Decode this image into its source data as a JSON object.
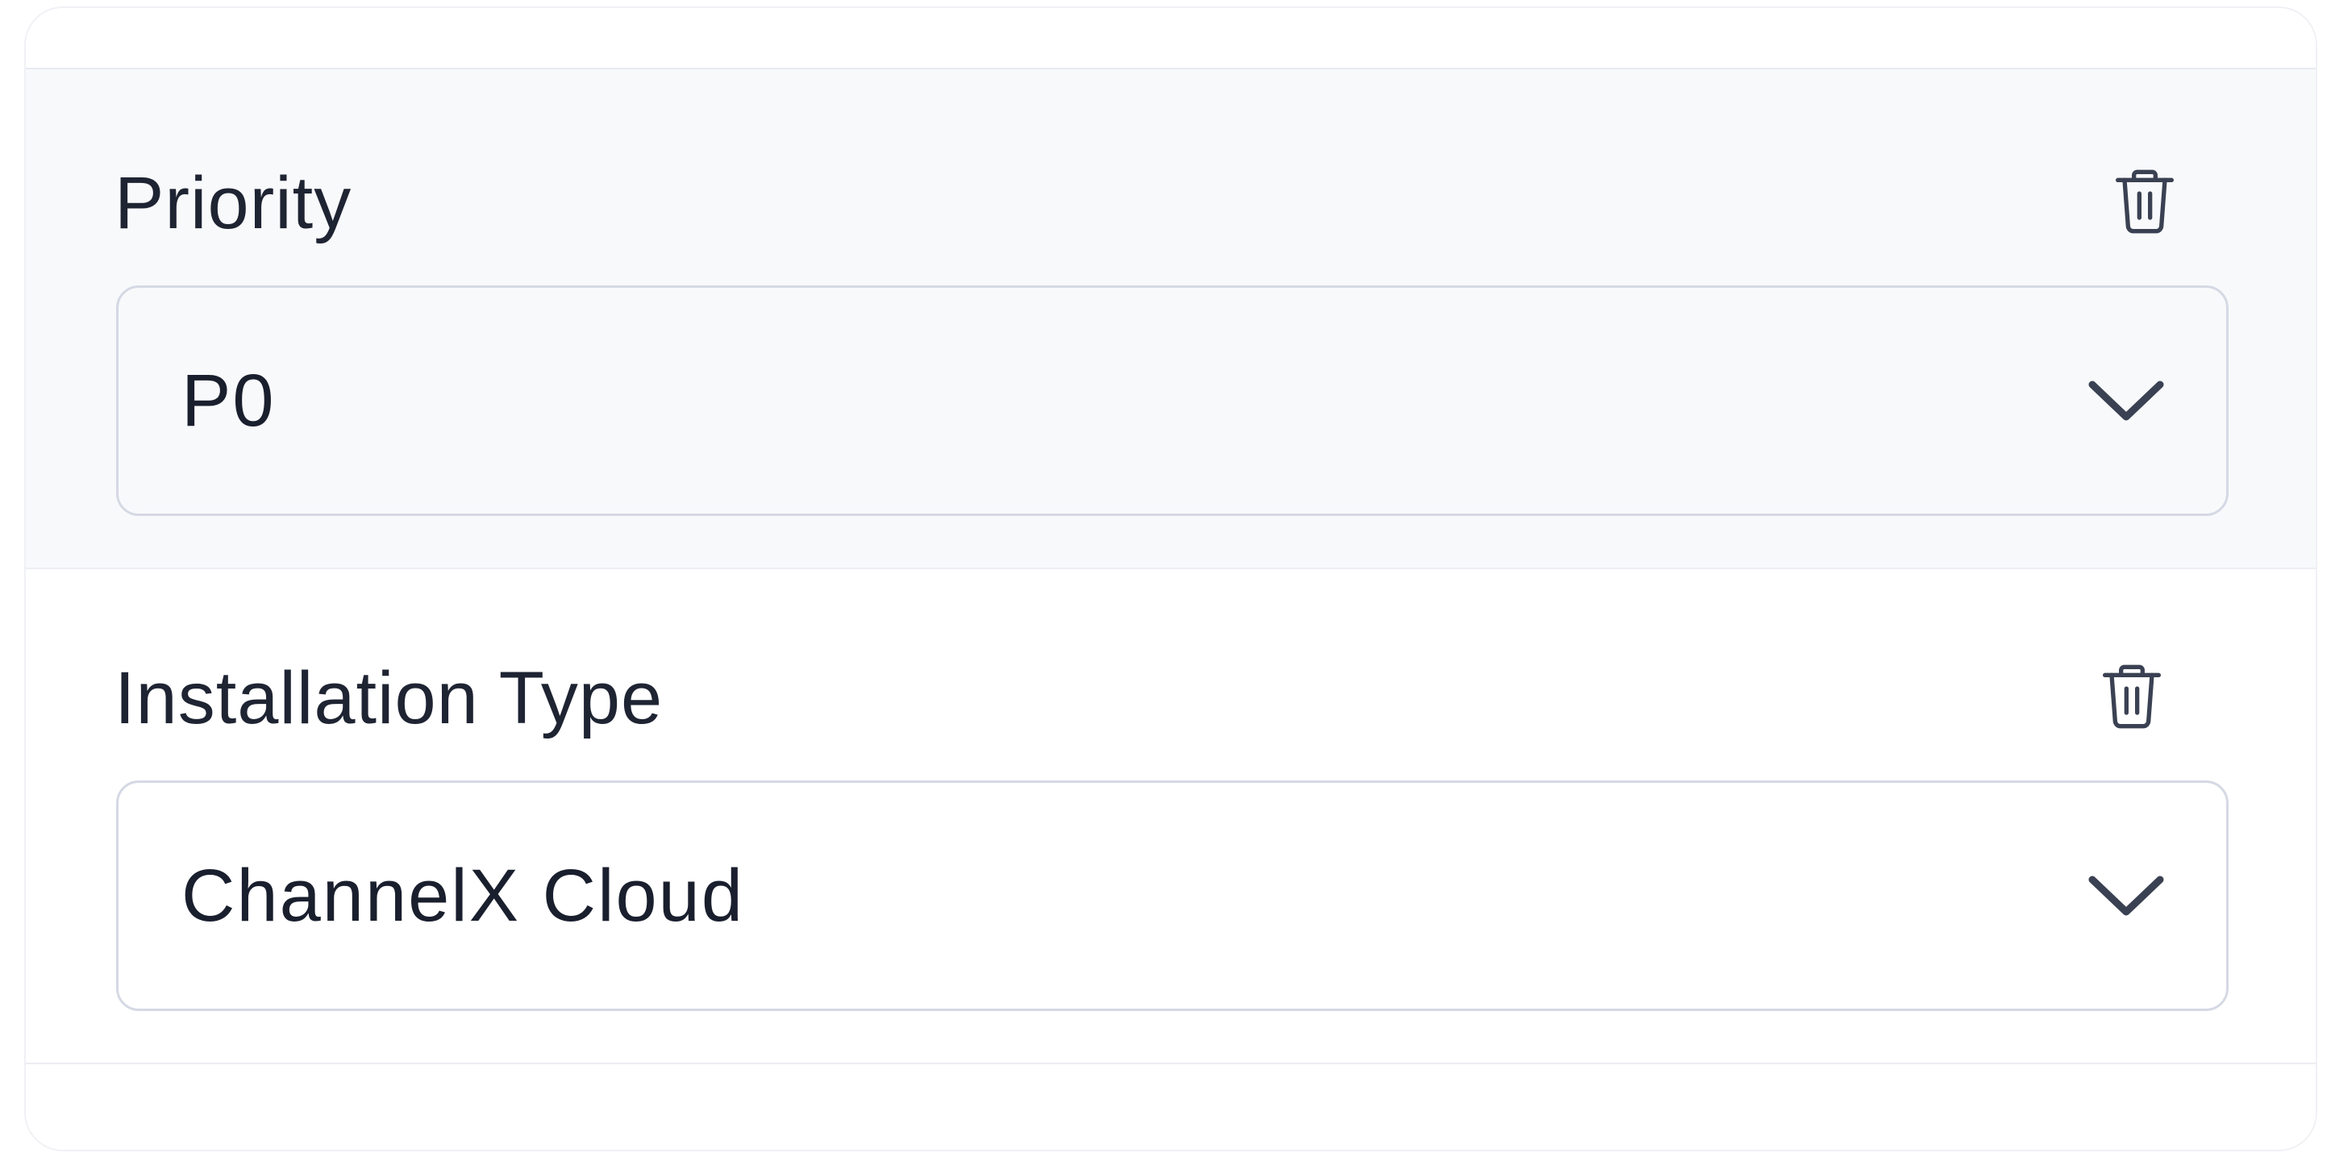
{
  "filters": [
    {
      "label": "Priority",
      "value": "P0",
      "delete_icon": "trash-icon",
      "dropdown_icon": "chevron-down-icon"
    },
    {
      "label": "Installation Type",
      "value": "ChannelX Cloud",
      "delete_icon": "trash-icon",
      "dropdown_icon": "chevron-down-icon"
    }
  ],
  "colors": {
    "text": "#1f2433",
    "icon": "#3a4152",
    "border": "#d5d9e4",
    "section_bg": "#f8f9fb"
  }
}
